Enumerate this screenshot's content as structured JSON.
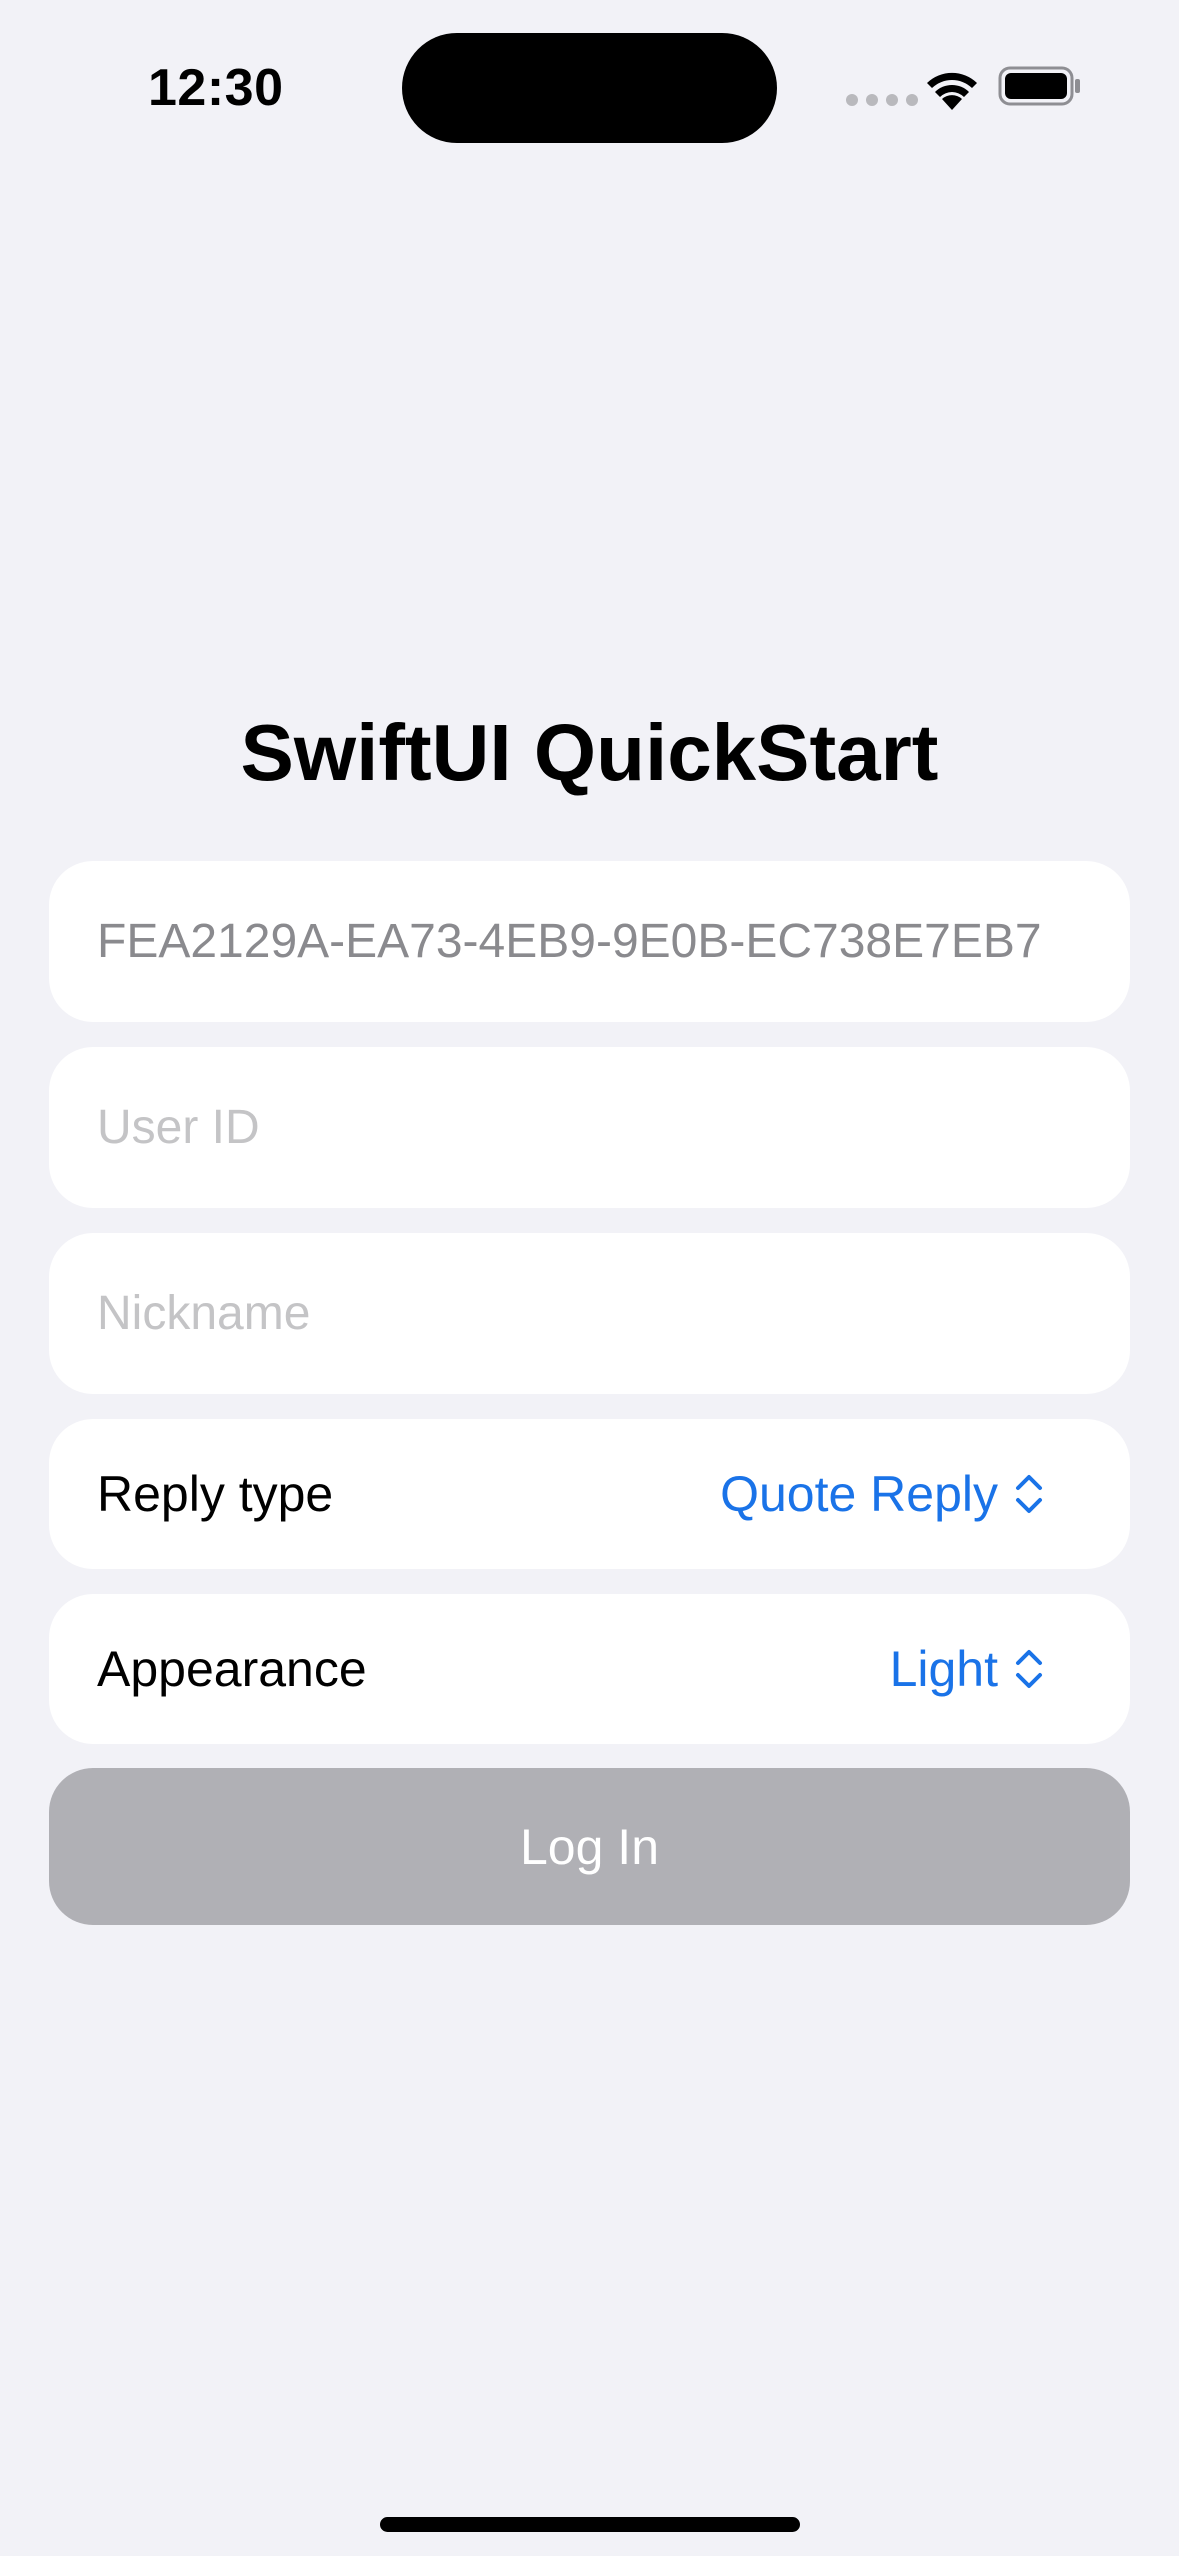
{
  "status_bar": {
    "time": "12:30",
    "wifi_icon": "wifi-icon",
    "battery_icon": "battery-icon"
  },
  "title": "SwiftUI QuickStart",
  "form": {
    "app_id_value": "FEA2129A-EA73-4EB9-9E0B-EC738E7EB7",
    "user_id_placeholder": "User ID",
    "nickname_placeholder": "Nickname",
    "reply_type": {
      "label": "Reply type",
      "value": "Quote Reply",
      "icon": "chevron-up-down-icon"
    },
    "appearance": {
      "label": "Appearance",
      "value": "Light",
      "icon": "chevron-up-down-icon"
    },
    "login_label": "Log In"
  },
  "colors": {
    "background": "#f2f2f7",
    "accent": "#1a73e8",
    "disabled_button": "#b0b0b5"
  }
}
